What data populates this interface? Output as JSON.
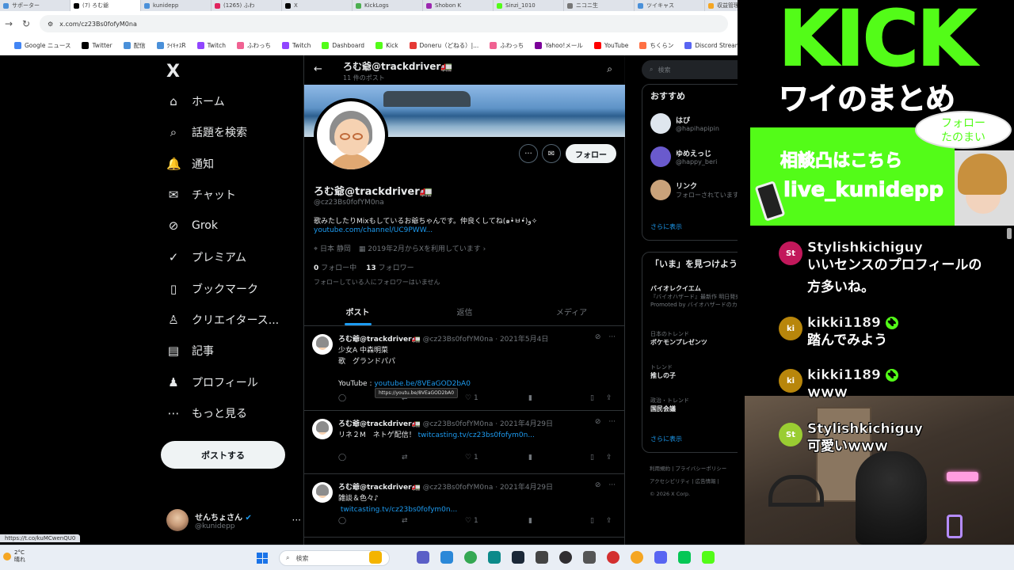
{
  "browser": {
    "tabs": [
      {
        "label": "サポーター",
        "color": "#4a90d9"
      },
      {
        "label": "(7) ろむ爺",
        "color": "#000000",
        "active": true
      },
      {
        "label": "kunidepp",
        "color": "#4a90d9"
      },
      {
        "label": "(1265) ふわ",
        "color": "#e0245e"
      },
      {
        "label": "X",
        "color": "#000000"
      },
      {
        "label": "KickLogs",
        "color": "#4caf50"
      },
      {
        "label": "Shobon K",
        "color": "#9c27b0"
      },
      {
        "label": "Sinzi_1010",
        "color": "#53fc18"
      },
      {
        "label": "ニコニ生",
        "color": "#777777"
      },
      {
        "label": "ツイキャス",
        "color": "#4a90d9"
      },
      {
        "label": "収益管理",
        "color": "#f5a623"
      }
    ],
    "url": "x.com/cz23Bs0fofyM0na",
    "bookmarks": [
      {
        "label": "Google ニュース",
        "color": "#4285f4"
      },
      {
        "label": "Twitter",
        "color": "#000000"
      },
      {
        "label": "配信",
        "color": "#4a90d9"
      },
      {
        "label": "ﾂｲｷｬｽR",
        "color": "#4a90d9"
      },
      {
        "label": "Twitch",
        "color": "#9146ff"
      },
      {
        "label": "ふわっち",
        "color": "#f06292"
      },
      {
        "label": "Twitch",
        "color": "#9146ff"
      },
      {
        "label": "Dashboard",
        "color": "#53fc18"
      },
      {
        "label": "Kick",
        "color": "#53fc18"
      },
      {
        "label": "Doneru（どねる）|...",
        "color": "#e53935"
      },
      {
        "label": "ふわっち",
        "color": "#f06292"
      },
      {
        "label": "Yahoo!メール",
        "color": "#7b0099"
      },
      {
        "label": "YouTube",
        "color": "#ff0000"
      },
      {
        "label": "ちくらン",
        "color": "#ff7043"
      },
      {
        "label": "Discord StreamKit O...",
        "color": "#5865f2"
      }
    ]
  },
  "nav": {
    "logo": "X",
    "items": [
      {
        "label": "ホーム",
        "icon": "⌂"
      },
      {
        "label": "話題を検索",
        "icon": "⌕"
      },
      {
        "label": "通知",
        "icon": "🔔"
      },
      {
        "label": "チャット",
        "icon": "✉"
      },
      {
        "label": "Grok",
        "icon": "⊘"
      },
      {
        "label": "プレミアム",
        "icon": "✓"
      },
      {
        "label": "ブックマーク",
        "icon": "▯"
      },
      {
        "label": "クリエイタース...",
        "icon": "♙"
      },
      {
        "label": "記事",
        "icon": "▤"
      },
      {
        "label": "プロフィール",
        "icon": "♟"
      },
      {
        "label": "もっと見る",
        "icon": "⋯"
      }
    ],
    "post_button": "ポストする",
    "account": {
      "name": "せんちょさん",
      "handle": "@kunidepp",
      "more": "···"
    }
  },
  "profile": {
    "header_title": "ろむ爺@trackdriver🚛",
    "header_sub": "11 件のポスト",
    "name": "ろむ爺@trackdriver🚛",
    "handle": "@cz23Bs0fofYM0na",
    "bio": "歌みたしたりMixもしているお爺ちゃんです。仲良くしてね(๑•̀ㅂ•́)و✧",
    "link": "youtube.com/channel/UC9PWW...",
    "location": "日本 静岡",
    "joined": "2019年2月からXを利用しています",
    "following_count": "0",
    "following_label": "フォロー中",
    "followers_count": "13",
    "followers_label": "フォロワー",
    "no_mutual": "フォローしている人にフォロワーはいません",
    "follow_button": "フォロー",
    "tabs": [
      "ポスト",
      "返信",
      "メディア"
    ]
  },
  "tweets": [
    {
      "name": "ろむ爺@trackdriver🚛",
      "meta": "@cz23Bs0fofYM0na · 2021年5月4日",
      "text": "少女A 中森明菜\n歌　グランドパパ\n\nYouTube : ",
      "link": "youtube.be/8VEaGOD2bA0",
      "likes": "1"
    },
    {
      "name": "ろむ爺@trackdriver🚛",
      "meta": "@cz23Bs0fofYM0na · 2021年4月29日",
      "text": "リネ２M　ネトゲ配信！ ",
      "link": "twitcasting.tv/cz23bs0fofym0n...",
      "likes": "1"
    },
    {
      "name": "ろむ爺@trackdriver🚛",
      "meta": "@cz23Bs0fofYM0na · 2021年4月29日",
      "text": "雑談＆色々♪\n ",
      "link": "twitcasting.tv/cz23bs0fofym0n...",
      "likes": "1"
    },
    {
      "name": "ろむ爺@trackdriver🚛",
      "meta": "@cz23Bs0fofYM0na · 2021年4月27日",
      "text": "",
      "link": "",
      "likes": ""
    }
  ],
  "tooltip": "https://youtu.be/8VEaGOD2bA0",
  "right": {
    "search_placeholder": "検索",
    "recommend_title": "おすすめ",
    "users": [
      {
        "name": "はぴ",
        "handle": "@hapihapipin",
        "color": "#dfe6ee"
      },
      {
        "name": "ゆめえっじ",
        "handle": "@happy_beri",
        "color": "#6a5acd"
      },
      {
        "name": "リンク",
        "handle": "フォローされています",
        "color": "#c9a27a"
      }
    ],
    "show_more": "さらに表示",
    "trends_title": "「いま」を見つけよう",
    "trends": [
      {
        "cat": "",
        "title": "バイオレクイエム",
        "desc": "『バイオハザード』最新作 明日発売！",
        "promo": "Promoted by バイオハザードのカプコン"
      },
      {
        "cat": "日本のトレンド",
        "title": "ポケモンプレゼンツ"
      },
      {
        "cat": "トレンド",
        "title": "推しの子"
      },
      {
        "cat": "政治・トレンド",
        "title": "国民会議"
      }
    ],
    "show_more2": "さらに表示",
    "footer": [
      "利用規約 | プライバシーポリシー",
      "アクセシビリティ | 広告情報 |",
      "© 2026 X Corp."
    ]
  },
  "overlay": {
    "kick": "KICK",
    "matome": "ワイのまとめ",
    "bubble": [
      "フォロー",
      "たのまい"
    ],
    "promo_line1": "相談凸はこちら",
    "promo_line2": "live_kunidepp",
    "chat": [
      {
        "badge": "St",
        "color": "#c2185b",
        "user": "Stylishkichiguy",
        "verified": false,
        "msg": "いいセンスのプロフィールの\n方多いね。"
      },
      {
        "badge": "ki",
        "color": "#b8860b",
        "user": "kikki1189",
        "verified": true,
        "msg": "踏んでみよう"
      },
      {
        "badge": "ki",
        "color": "#b8860b",
        "user": "kikki1189",
        "verified": true,
        "msg": "ｗｗｗ"
      },
      {
        "badge": "St",
        "color": "#9acd32",
        "user": "Stylishkichiguy",
        "verified": false,
        "msg": "可愛いｗｗｗ"
      }
    ]
  },
  "status_link": "https://t.co/kuMCwenQU0",
  "taskbar": {
    "temp": "2°C",
    "weather": "晴れ",
    "search_placeholder": "検索",
    "apps": [
      {
        "name": "files",
        "color": "#f4b400"
      },
      {
        "name": "teams",
        "color": "#5b5fc7"
      },
      {
        "name": "photos",
        "color": "#2b88d8"
      },
      {
        "name": "chrome",
        "color": "#34a853"
      },
      {
        "name": "edge",
        "color": "#0c8a8a"
      },
      {
        "name": "steam",
        "color": "#1b2838"
      },
      {
        "name": "terminal",
        "color": "#444444"
      },
      {
        "name": "obs",
        "color": "#302e31"
      },
      {
        "name": "gamepad",
        "color": "#555555"
      },
      {
        "name": "record",
        "color": "#d32f2f"
      },
      {
        "name": "coin",
        "color": "#f5a623"
      },
      {
        "name": "discord",
        "color": "#5865f2"
      },
      {
        "name": "line",
        "color": "#06c755"
      },
      {
        "name": "kick",
        "color": "#53fc18"
      }
    ]
  }
}
